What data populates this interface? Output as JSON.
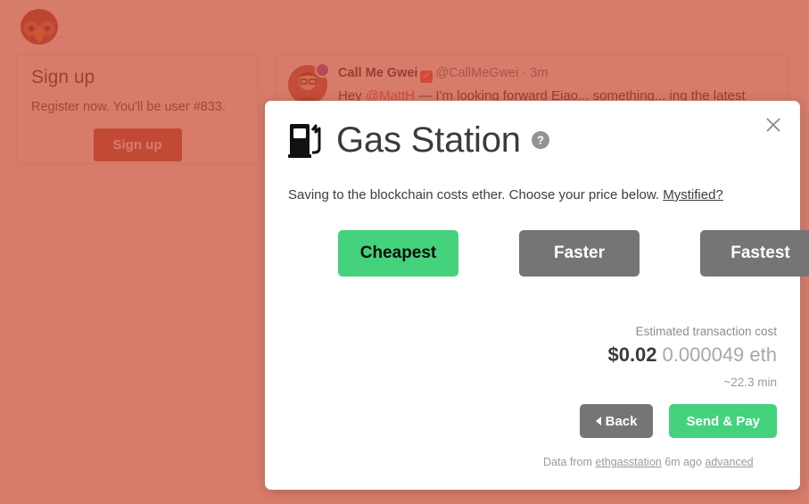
{
  "app": {
    "logo_icon": "owl-bird-logo"
  },
  "sidebar": {
    "signup_card": {
      "title": "Sign up",
      "description": "Register now. You'll be user #833.",
      "button_label": "Sign up"
    }
  },
  "feed": {
    "tweet": {
      "display_name": "Call Me Gwei",
      "verified_icon": "verified-badge-icon",
      "verified_glyph": "✓",
      "handle": "@CallMeGwei",
      "timestamp": "3m",
      "separator": "·",
      "text_prefix": "Hey ",
      "mention": "@MattH",
      "text_rest": " — I'm looking forward Eiao... something... ing the latest thing"
    }
  },
  "modal": {
    "pump_icon": "gas-pump-icon",
    "title": "Gas Station",
    "help_icon": "help-question-icon",
    "close_icon": "close-x-icon",
    "description_prefix": "Saving to the blockchain costs ether. Choose your price below.",
    "mystified_link": "Mystified?",
    "speed_options": [
      {
        "label": "Cheapest",
        "selected": true
      },
      {
        "label": "Faster",
        "selected": false
      },
      {
        "label": "Fastest",
        "selected": false
      }
    ],
    "cost": {
      "label": "Estimated transaction cost",
      "fiat": "$0.02",
      "eth": "0.000049 eth",
      "time": "~22.3 min"
    },
    "actions": {
      "back_label": "Back",
      "back_icon": "triangle-left-icon",
      "send_label": "Send & Pay"
    },
    "footer": {
      "prefix": "Data from",
      "source_link": "ethgasstation",
      "updated": "6m ago",
      "advanced_link": "advanced"
    }
  },
  "colors": {
    "overlay": "#cd6f5f",
    "accent_green": "#44d27d",
    "gray_button": "#757575",
    "brand_red": "#e8503a"
  }
}
